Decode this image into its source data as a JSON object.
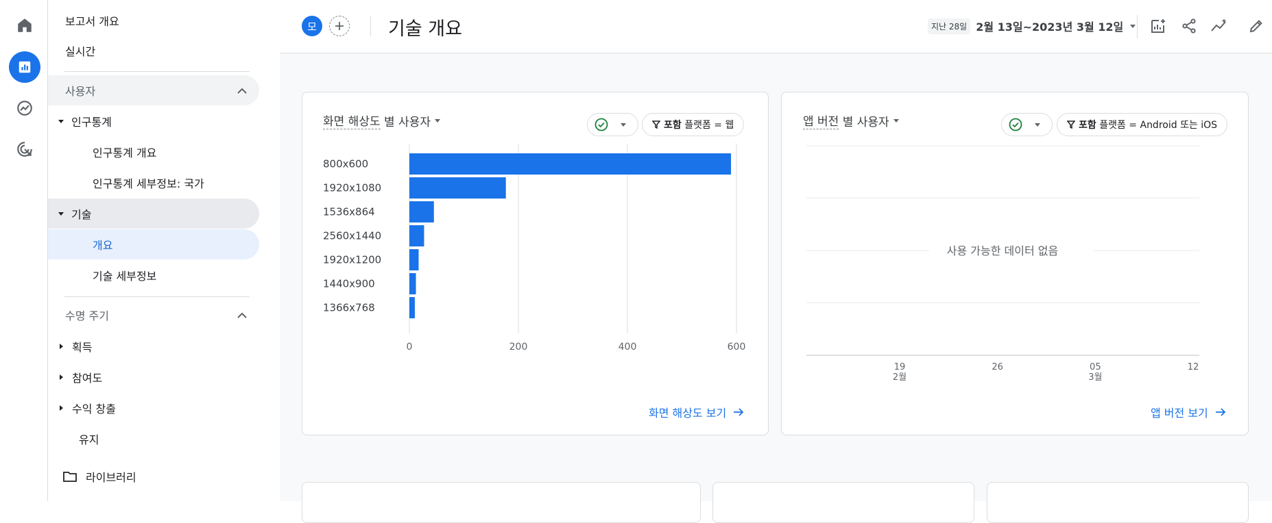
{
  "rail": {
    "icons": [
      "home-icon",
      "reports-icon",
      "explore-icon",
      "advertising-icon"
    ],
    "active_color": "#1a73e8"
  },
  "nav": {
    "reports_snapshot": "보고서 개요",
    "realtime": "실시간",
    "users_section": "사용자",
    "demographics": "인구통계",
    "demographics_overview": "인구통계 개요",
    "demographics_details": "인구통계 세부정보: 국가",
    "tech": "기술",
    "tech_overview": "개요",
    "tech_details": "기술 세부정보",
    "lifecycle_section": "수명 주기",
    "acquisition": "획득",
    "engagement": "참여도",
    "monetization": "수익 창출",
    "retention": "유지",
    "library": "라이브러리"
  },
  "header": {
    "avatar_letter": "모",
    "title": "기술 개요",
    "date_badge": "지난 28일",
    "date_range": "2월 13일~2023년 3월 12일"
  },
  "card1": {
    "title_prefix": "화면 해상도",
    "title_suffix": " 별 사용자",
    "filter_bold": "포함",
    "filter_text": " 플랫폼 = 웹",
    "view_link": "화면 해상도 보기"
  },
  "card2": {
    "title_prefix": "앱 버전",
    "title_suffix": " 별 사용자",
    "filter_bold": "포함",
    "filter_text": " 플랫폼 = Android 또는 iOS",
    "no_data": "사용 가능한 데이터 없음",
    "x_ticks": [
      {
        "day": "19",
        "month": "2월"
      },
      {
        "day": "26",
        "month": ""
      },
      {
        "day": "05",
        "month": "3월"
      },
      {
        "day": "12",
        "month": ""
      }
    ],
    "view_link": "앱 버전 보기"
  },
  "chart_data": {
    "type": "bar",
    "orientation": "horizontal",
    "categories": [
      "800x600",
      "1920x1080",
      "1536x864",
      "2560x1440",
      "1920x1200",
      "1440x900",
      "1366x768"
    ],
    "values": [
      590,
      177,
      45,
      27,
      17,
      12,
      10
    ],
    "xlim": [
      0,
      600
    ],
    "x_ticks": [
      "0",
      "200",
      "400",
      "600"
    ],
    "grid": true,
    "bar_color": "#1a73e8"
  },
  "colors": {
    "accent": "#1a73e8",
    "check": "#188038"
  }
}
